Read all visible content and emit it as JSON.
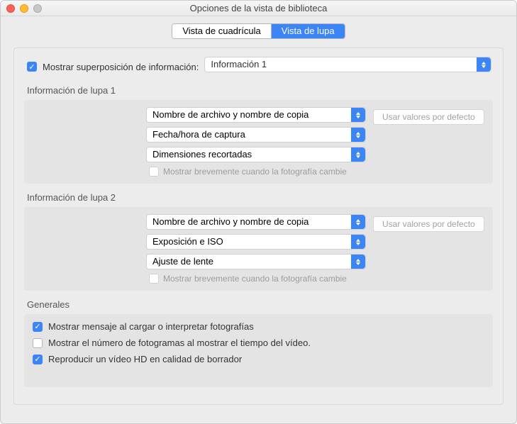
{
  "window": {
    "title": "Opciones de la vista de biblioteca"
  },
  "tabs": {
    "grid": "Vista de cuadrícula",
    "loupe": "Vista de lupa"
  },
  "overlay": {
    "checkboxLabel": "Mostrar superposición de información:",
    "select": "Información 1"
  },
  "loupe1": {
    "heading": "Información de lupa 1",
    "s1": "Nombre de archivo y nombre de copia",
    "s2": "Fecha/hora de captura",
    "s3": "Dimensiones recortadas",
    "brief": "Mostrar brevemente cuando la fotografía cambie",
    "reset": "Usar valores por defecto"
  },
  "loupe2": {
    "heading": "Información de lupa 2",
    "s1": "Nombre de archivo y nombre de copia",
    "s2": "Exposición e ISO",
    "s3": "Ajuste de lente",
    "brief": "Mostrar brevemente cuando la fotografía cambie",
    "reset": "Usar valores por defecto"
  },
  "generals": {
    "heading": "Generales",
    "c1": "Mostrar mensaje al cargar o interpretar fotografías",
    "c2": "Mostrar el número de fotogramas al mostrar el tiempo del vídeo.",
    "c3": "Reproducir un vídeo HD en calidad de borrador"
  }
}
